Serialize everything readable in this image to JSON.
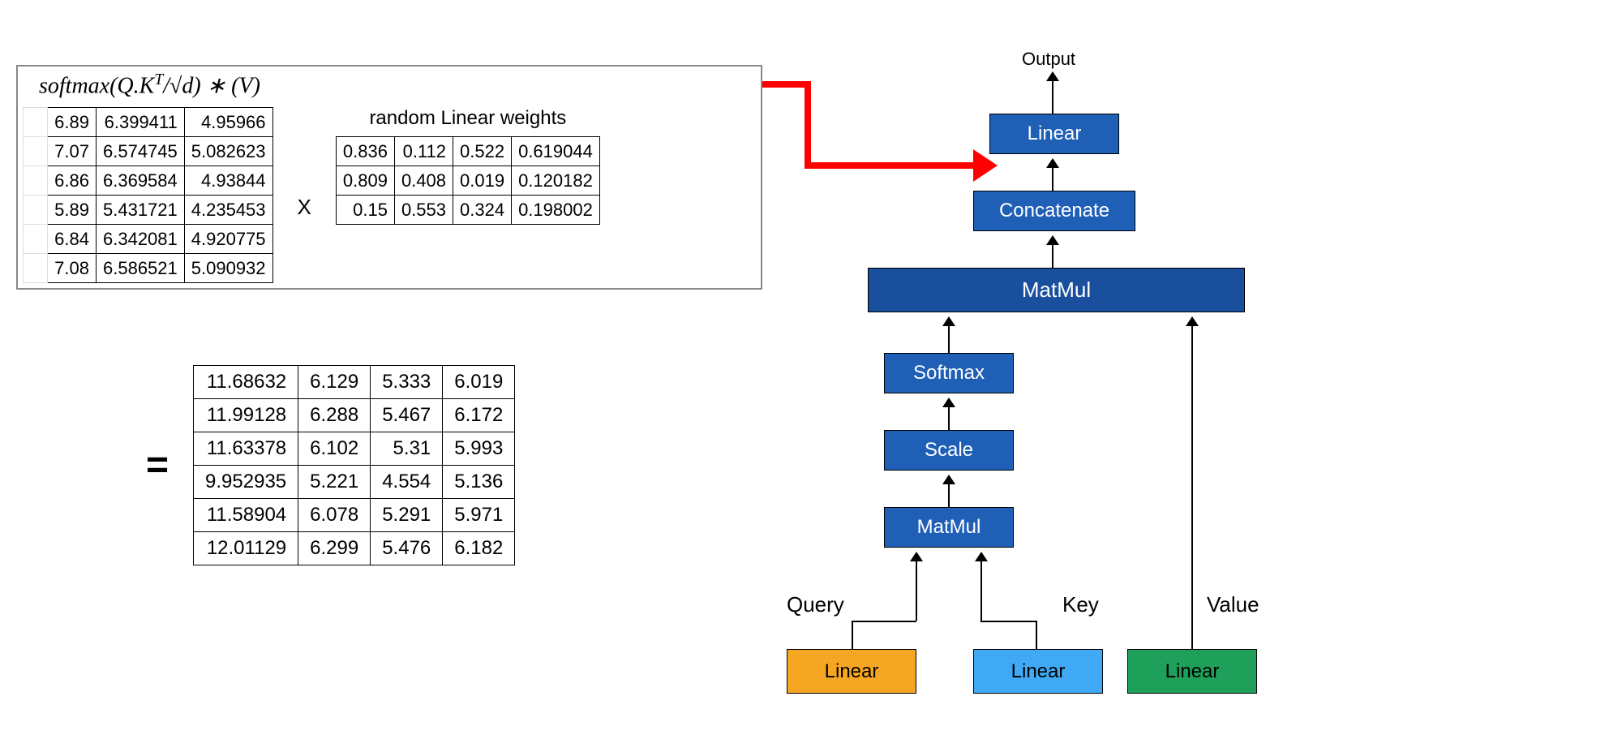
{
  "left": {
    "formula_prefix": "softmax",
    "formula_inner": "(Q.K",
    "formula_sup": "T",
    "formula_rest": "/√d)  ∗  (V)",
    "weights_title": "random Linear weights",
    "mult": "X",
    "eq": "=",
    "matrixA": [
      [
        "6.89",
        "6.399411",
        "4.95966"
      ],
      [
        "7.07",
        "6.574745",
        "5.082623"
      ],
      [
        "6.86",
        "6.369584",
        "4.93844"
      ],
      [
        "5.89",
        "5.431721",
        "4.235453"
      ],
      [
        "6.84",
        "6.342081",
        "4.920775"
      ],
      [
        "7.08",
        "6.586521",
        "5.090932"
      ]
    ],
    "matrixB": [
      [
        "0.836",
        "0.112",
        "0.522",
        "0.619044"
      ],
      [
        "0.809",
        "0.408",
        "0.019",
        "0.120182"
      ],
      [
        "0.15",
        "0.553",
        "0.324",
        "0.198002"
      ]
    ],
    "result": [
      [
        "11.68632",
        "6.129",
        "5.333",
        "6.019"
      ],
      [
        "11.99128",
        "6.288",
        "5.467",
        "6.172"
      ],
      [
        "11.63378",
        "6.102",
        "5.31",
        "5.993"
      ],
      [
        "9.952935",
        "5.221",
        "4.554",
        "5.136"
      ],
      [
        "11.58904",
        "6.078",
        "5.291",
        "5.971"
      ],
      [
        "12.01129",
        "6.299",
        "5.476",
        "6.182"
      ]
    ]
  },
  "right": {
    "output": "Output",
    "linear": "Linear",
    "concat": "Concatenate",
    "matmul": "MatMul",
    "softmax": "Softmax",
    "scale": "Scale",
    "query": "Query",
    "key": "Key",
    "value": "Value"
  }
}
